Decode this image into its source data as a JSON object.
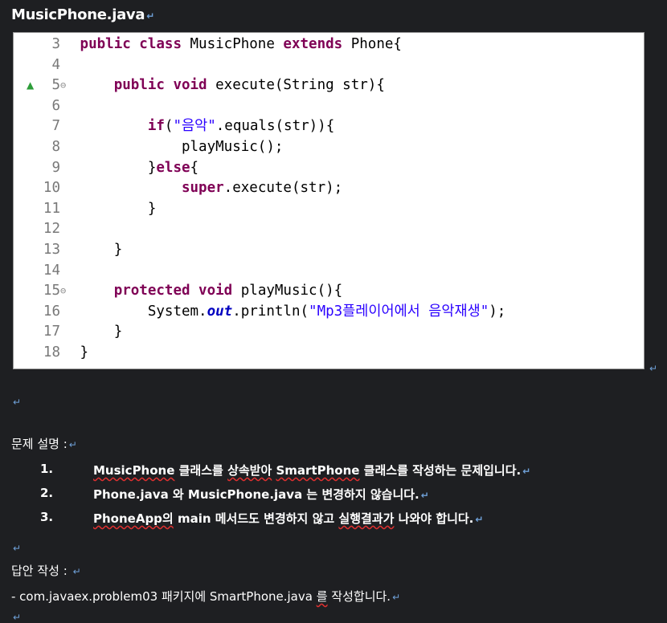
{
  "title": "MusicPhone.java",
  "return_mark": "↵",
  "code": [
    {
      "num": "3",
      "fold": "",
      "marker": "",
      "tokens": [
        {
          "t": "kw",
          "v": "public class"
        },
        {
          "t": "txt",
          "v": " MusicPhone "
        },
        {
          "t": "kw",
          "v": "extends"
        },
        {
          "t": "txt",
          "v": " Phone{"
        }
      ]
    },
    {
      "num": "4",
      "fold": "",
      "marker": "",
      "tokens": []
    },
    {
      "num": "5",
      "fold": "⊖",
      "marker": "▲",
      "tokens": [
        {
          "t": "txt",
          "v": "    "
        },
        {
          "t": "kw",
          "v": "public void"
        },
        {
          "t": "txt",
          "v": " execute(String str){"
        }
      ]
    },
    {
      "num": "6",
      "fold": "",
      "marker": "",
      "tokens": []
    },
    {
      "num": "7",
      "fold": "",
      "marker": "",
      "tokens": [
        {
          "t": "txt",
          "v": "        "
        },
        {
          "t": "kw",
          "v": "if"
        },
        {
          "t": "txt",
          "v": "("
        },
        {
          "t": "str",
          "v": "\"음악\""
        },
        {
          "t": "txt",
          "v": ".equals(str)){"
        }
      ]
    },
    {
      "num": "8",
      "fold": "",
      "marker": "",
      "tokens": [
        {
          "t": "txt",
          "v": "            playMusic();"
        }
      ]
    },
    {
      "num": "9",
      "fold": "",
      "marker": "",
      "tokens": [
        {
          "t": "txt",
          "v": "        }"
        },
        {
          "t": "kw",
          "v": "else"
        },
        {
          "t": "txt",
          "v": "{"
        }
      ]
    },
    {
      "num": "10",
      "fold": "",
      "marker": "",
      "tokens": [
        {
          "t": "txt",
          "v": "            "
        },
        {
          "t": "kw",
          "v": "super"
        },
        {
          "t": "txt",
          "v": ".execute(str);"
        }
      ]
    },
    {
      "num": "11",
      "fold": "",
      "marker": "",
      "tokens": [
        {
          "t": "txt",
          "v": "        }"
        }
      ]
    },
    {
      "num": "12",
      "fold": "",
      "marker": "",
      "tokens": []
    },
    {
      "num": "13",
      "fold": "",
      "marker": "",
      "tokens": [
        {
          "t": "txt",
          "v": "    }"
        }
      ]
    },
    {
      "num": "14",
      "fold": "",
      "marker": "",
      "tokens": []
    },
    {
      "num": "15",
      "fold": "⊖",
      "marker": "",
      "tokens": [
        {
          "t": "txt",
          "v": "    "
        },
        {
          "t": "kw",
          "v": "protected void"
        },
        {
          "t": "txt",
          "v": " playMusic(){"
        }
      ]
    },
    {
      "num": "16",
      "fold": "",
      "marker": "",
      "tokens": [
        {
          "t": "txt",
          "v": "        System."
        },
        {
          "t": "fld",
          "v": "out"
        },
        {
          "t": "txt",
          "v": ".println("
        },
        {
          "t": "str",
          "v": "\"Mp3플레이어에서 음악재생\""
        },
        {
          "t": "txt",
          "v": ");"
        }
      ]
    },
    {
      "num": "17",
      "fold": "",
      "marker": "",
      "tokens": [
        {
          "t": "txt",
          "v": "    }"
        }
      ]
    },
    {
      "num": "18",
      "fold": "",
      "marker": "",
      "tokens": [
        {
          "t": "txt",
          "v": "}"
        }
      ]
    }
  ],
  "problem_heading": "문제 설명 :",
  "problems": [
    {
      "num": "1.",
      "segments": [
        {
          "v": "MusicPhone",
          "sq": true
        },
        {
          "v": " 클래스를 ",
          "sq": false
        },
        {
          "v": "상속받아",
          "sq": true
        },
        {
          "v": " ",
          "sq": false
        },
        {
          "v": "SmartPhone",
          "sq": true
        },
        {
          "v": " 클래스를 작성하는 문제입니다.",
          "sq": false
        }
      ]
    },
    {
      "num": "2.",
      "segments": [
        {
          "v": "Phone.java 와 MusicPhone.java 는 변경하지 않습니다.",
          "sq": false
        }
      ]
    },
    {
      "num": "3.",
      "segments": [
        {
          "v": "PhoneApp의",
          "sq": true
        },
        {
          "v": " main 메서드도 변경하지 않고 ",
          "sq": false
        },
        {
          "v": "실행결과가",
          "sq": true
        },
        {
          "v": " 나와야 합니다.",
          "sq": false
        }
      ]
    }
  ],
  "answer_heading": "답안 작성 :",
  "answer_line_segments": [
    {
      "v": "- com.javaex.problem03 패키지에 SmartPhone.java ",
      "sq": false
    },
    {
      "v": "를",
      "sq": true
    },
    {
      "v": " 작성합니다.",
      "sq": false
    }
  ]
}
